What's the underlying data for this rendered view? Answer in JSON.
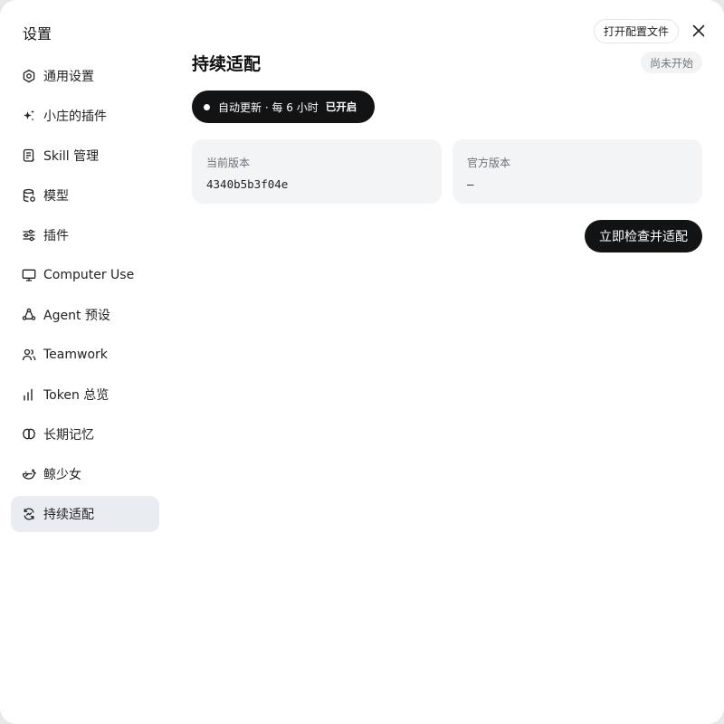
{
  "window": {
    "title": "设置"
  },
  "header": {
    "open_config_label": "打开配置文件",
    "close_icon": "close-icon"
  },
  "sidebar": {
    "items": [
      {
        "label": "通用设置",
        "icon": "gear-icon",
        "active": false
      },
      {
        "label": "小庄的插件",
        "icon": "sparkle-icon",
        "active": false
      },
      {
        "label": "Skill 管理",
        "icon": "document-icon",
        "active": false
      },
      {
        "label": "模型",
        "icon": "database-icon",
        "active": false
      },
      {
        "label": "插件",
        "icon": "sliders-icon",
        "active": false
      },
      {
        "label": "Computer Use",
        "icon": "monitor-icon",
        "active": false
      },
      {
        "label": "Agent 预设",
        "icon": "agent-cycle-icon",
        "active": false
      },
      {
        "label": "Teamwork",
        "icon": "users-icon",
        "active": false
      },
      {
        "label": "Token 总览",
        "icon": "bar-chart-icon",
        "active": false
      },
      {
        "label": "长期记忆",
        "icon": "brain-icon",
        "active": false
      },
      {
        "label": "鲸少女",
        "icon": "whale-icon",
        "active": false
      },
      {
        "label": "持续适配",
        "icon": "sync-icon",
        "active": true
      }
    ]
  },
  "main": {
    "title": "持续适配",
    "status": "尚未开始",
    "auto_update": {
      "label": "自动更新 · 每 6 小时",
      "state": "已开启"
    },
    "cards": [
      {
        "label": "当前版本",
        "value": "4340b5b3f04e"
      },
      {
        "label": "官方版本",
        "value": "—"
      }
    ],
    "check_button_label": "立即检查并适配"
  },
  "colors": {
    "accent_dark": "#111315",
    "active_item_bg": "#e9ecf0",
    "card_bg": "#f3f4f6",
    "status_bg": "#f2f3f5"
  }
}
